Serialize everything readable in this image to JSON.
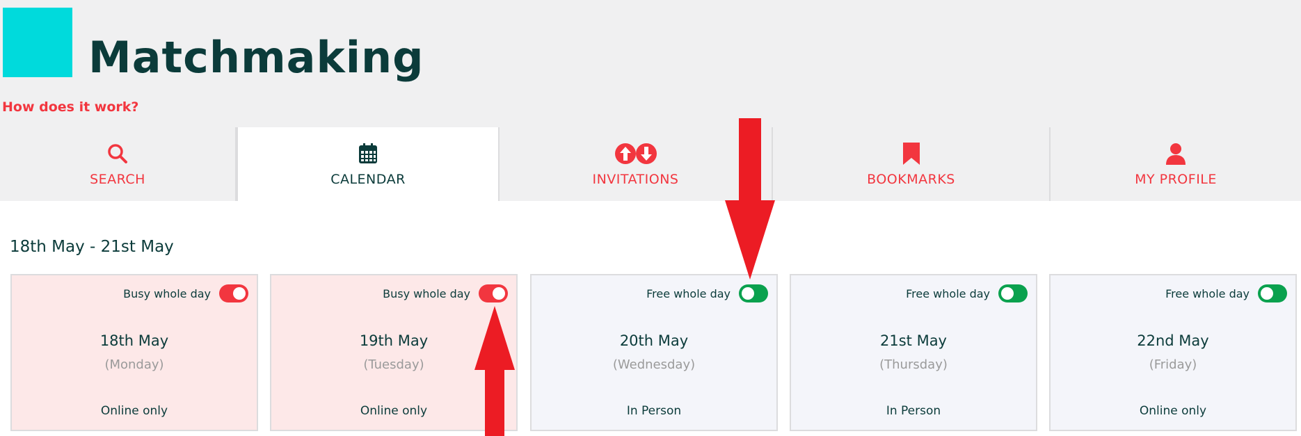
{
  "header": {
    "title": "Matchmaking",
    "help_link": "How does it work?"
  },
  "tabs": [
    {
      "label": "SEARCH",
      "icon": "search-icon",
      "active": false
    },
    {
      "label": "CALENDAR",
      "icon": "calendar-icon",
      "active": true
    },
    {
      "label": "INVITATIONS",
      "icon": "invitations-icon",
      "active": false
    },
    {
      "label": "BOOKMARKS",
      "icon": "bookmark-icon",
      "active": false
    },
    {
      "label": "MY PROFILE",
      "icon": "user-icon",
      "active": false
    }
  ],
  "calendar": {
    "range": "18th May - 21st May",
    "days": [
      {
        "status_label": "Busy whole day",
        "status": "busy",
        "date": "18th May",
        "weekday": "(Monday)",
        "mode": "Online only"
      },
      {
        "status_label": "Busy whole day",
        "status": "busy",
        "date": "19th May",
        "weekday": "(Tuesday)",
        "mode": "Online only"
      },
      {
        "status_label": "Free whole day",
        "status": "free",
        "date": "20th May",
        "weekday": "(Wednesday)",
        "mode": "In Person"
      },
      {
        "status_label": "Free whole day",
        "status": "free",
        "date": "21st May",
        "weekday": "(Thursday)",
        "mode": "In Person"
      },
      {
        "status_label": "Free whole day",
        "status": "free",
        "date": "22nd May",
        "weekday": "(Friday)",
        "mode": "Online only"
      }
    ]
  },
  "colors": {
    "accent": "#f2363f",
    "brand_dark": "#0b3b3a",
    "logo": "#00dadc",
    "free_toggle": "#0aa14e",
    "busy_card": "#fde8e8",
    "free_card": "#f4f5fa",
    "annotation_arrow": "#ec1c24"
  }
}
